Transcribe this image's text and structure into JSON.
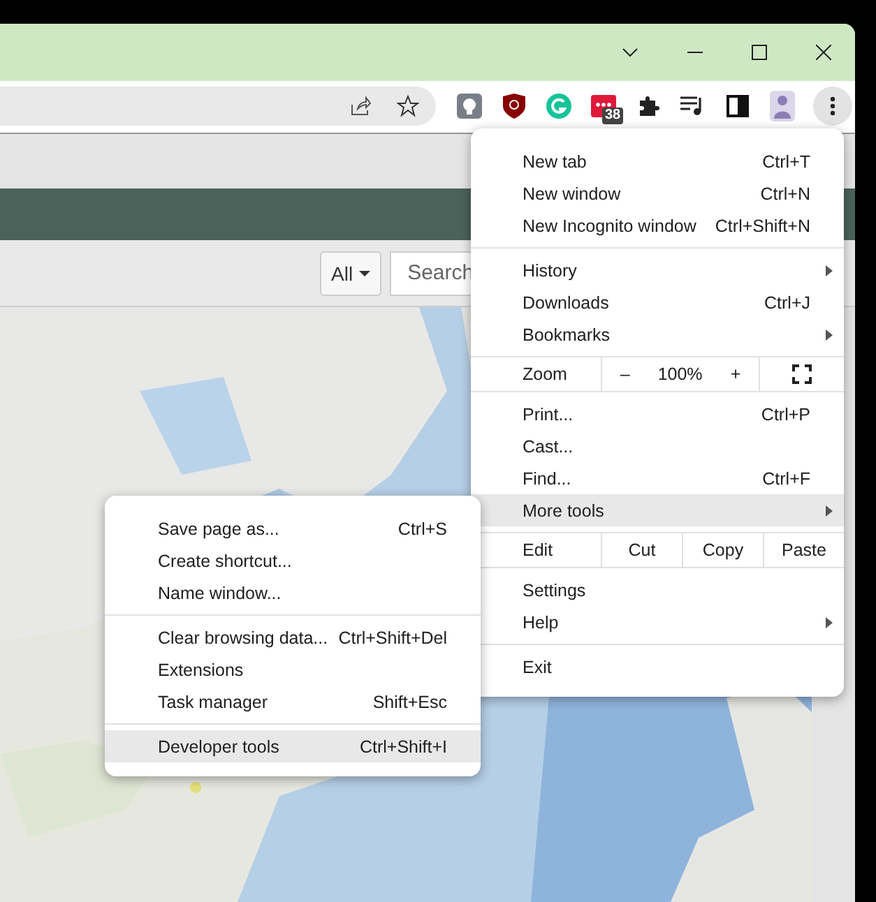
{
  "toolbar": {
    "extension_badge": "38"
  },
  "page": {
    "filter": {
      "label": "All"
    },
    "search": {
      "placeholder": "Search"
    }
  },
  "menu": {
    "sections": [
      [
        {
          "kind": "item",
          "label": "New tab",
          "shortcut": "Ctrl+T",
          "submenu": false,
          "selected": false
        },
        {
          "kind": "item",
          "label": "New window",
          "shortcut": "Ctrl+N",
          "submenu": false,
          "selected": false
        },
        {
          "kind": "item",
          "label": "New Incognito window",
          "shortcut": "Ctrl+Shift+N",
          "submenu": false,
          "selected": false
        }
      ],
      [
        {
          "kind": "item",
          "label": "History",
          "submenu": true,
          "selected": false
        },
        {
          "kind": "item",
          "label": "Downloads",
          "shortcut": "Ctrl+J",
          "submenu": false,
          "selected": false
        },
        {
          "kind": "item",
          "label": "Bookmarks",
          "submenu": true,
          "selected": false
        }
      ],
      [
        {
          "kind": "zoom",
          "label": "Zoom",
          "minus": "–",
          "value": "100%",
          "plus": "+"
        }
      ],
      [
        {
          "kind": "item",
          "label": "Print...",
          "shortcut": "Ctrl+P",
          "submenu": false,
          "selected": false
        },
        {
          "kind": "item",
          "label": "Cast...",
          "submenu": false,
          "selected": false
        },
        {
          "kind": "item",
          "label": "Find...",
          "shortcut": "Ctrl+F",
          "submenu": false,
          "selected": false
        },
        {
          "kind": "item",
          "label": "More tools",
          "submenu": true,
          "selected": true
        }
      ],
      [
        {
          "kind": "edit",
          "label": "Edit",
          "buttons": [
            "Cut",
            "Copy",
            "Paste"
          ]
        }
      ],
      [
        {
          "kind": "item",
          "label": "Settings",
          "submenu": false,
          "selected": false
        },
        {
          "kind": "item",
          "label": "Help",
          "submenu": true,
          "selected": false
        }
      ],
      [
        {
          "kind": "item",
          "label": "Exit",
          "submenu": false,
          "selected": false
        }
      ]
    ]
  },
  "submenu": {
    "sections": [
      [
        {
          "kind": "item",
          "label": "Save page as...",
          "shortcut": "Ctrl+S",
          "submenu": false,
          "selected": false
        },
        {
          "kind": "item",
          "label": "Create shortcut...",
          "submenu": false,
          "selected": false
        },
        {
          "kind": "item",
          "label": "Name window...",
          "submenu": false,
          "selected": false
        }
      ],
      [
        {
          "kind": "item",
          "label": "Clear browsing data...",
          "shortcut": "Ctrl+Shift+Del",
          "submenu": false,
          "selected": false
        },
        {
          "kind": "item",
          "label": "Extensions",
          "submenu": false,
          "selected": false
        },
        {
          "kind": "item",
          "label": "Task manager",
          "shortcut": "Shift+Esc",
          "submenu": false,
          "selected": false
        }
      ],
      [
        {
          "kind": "item",
          "label": "Developer tools",
          "shortcut": "Ctrl+Shift+I",
          "submenu": false,
          "selected": true
        }
      ]
    ]
  }
}
